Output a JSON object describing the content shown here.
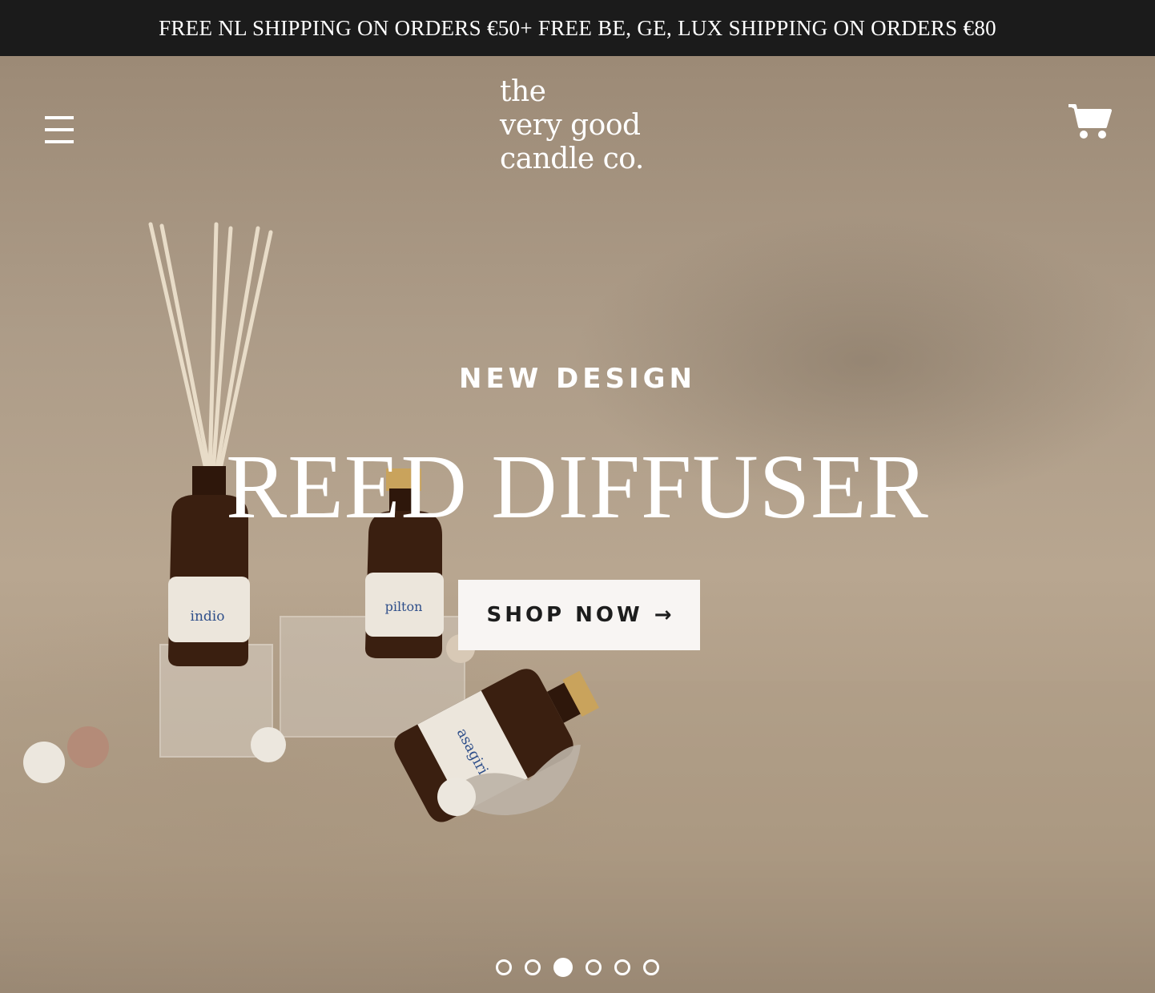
{
  "announcement": {
    "text": "FREE NL SHIPPING ON ORDERS €50+ FREE BE, GE, LUX SHIPPING ON ORDERS €80"
  },
  "header": {
    "menu_icon": "hamburger-icon",
    "logo_lines": [
      "the",
      "very good",
      "candle co."
    ],
    "cart_icon": "cart-icon"
  },
  "hero": {
    "eyebrow": "NEW DESIGN",
    "headline": "REED DIFFUSER",
    "cta_label": "SHOP NOW",
    "cta_arrow": "→",
    "bottle_labels": [
      "indio",
      "pilton",
      "asagiri"
    ],
    "slide_count": 6,
    "active_slide": 3
  },
  "colors": {
    "announcement_bg": "#1b1b1b",
    "hero_bg": "#a89886",
    "text_light": "#ffffff",
    "cta_bg": "#f8f5f3",
    "cta_text": "#1d1d1d",
    "bottle_glass": "#3a1f10",
    "label_text": "#2f4f8a"
  }
}
